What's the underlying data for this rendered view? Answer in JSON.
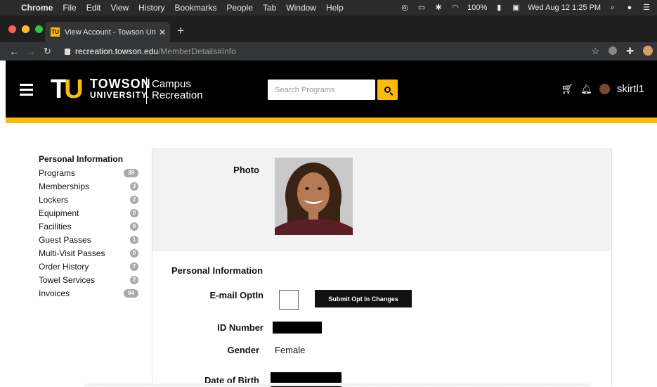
{
  "menubar": {
    "app": "Chrome",
    "items": [
      "File",
      "Edit",
      "View",
      "History",
      "Bookmarks",
      "People",
      "Tab",
      "Window",
      "Help"
    ],
    "battery": "100%",
    "datetime": "Wed Aug 12  1:25 PM"
  },
  "browser": {
    "tab_title": "View Account - Towson Univer",
    "url_host": "recreation.towson.edu",
    "url_path": "/MemberDetails#Info"
  },
  "header": {
    "logo_t": "T",
    "logo_u": "U",
    "logo_line1": "TOWSON",
    "logo_line2": "UNIVERSITY.",
    "campus_line1": "Campus",
    "campus_line2": "Recreation",
    "search_placeholder": "Search Programs",
    "username": "skirtl1",
    "brand_color": "#ffbb00"
  },
  "sidebar": {
    "title": "Personal Information",
    "items": [
      {
        "label": "Programs",
        "count": "38"
      },
      {
        "label": "Memberships",
        "count": "3"
      },
      {
        "label": "Lockers",
        "count": "2"
      },
      {
        "label": "Equipment",
        "count": "0"
      },
      {
        "label": "Facilities",
        "count": "0"
      },
      {
        "label": "Guest Passes",
        "count": "1"
      },
      {
        "label": "Multi-Visit Passes",
        "count": "0"
      },
      {
        "label": "Order History",
        "count": "7"
      },
      {
        "label": "Towel Services",
        "count": "2"
      },
      {
        "label": "Invoices",
        "count": "94"
      }
    ]
  },
  "main": {
    "photo_label": "Photo",
    "section_title": "Personal Information",
    "email_optin_label": "E-mail OptIn",
    "submit_button": "Submit Opt In Changes",
    "id_label": "ID Number",
    "gender_label": "Gender",
    "gender_value": "Female",
    "dob_label": "Date of Birth"
  }
}
